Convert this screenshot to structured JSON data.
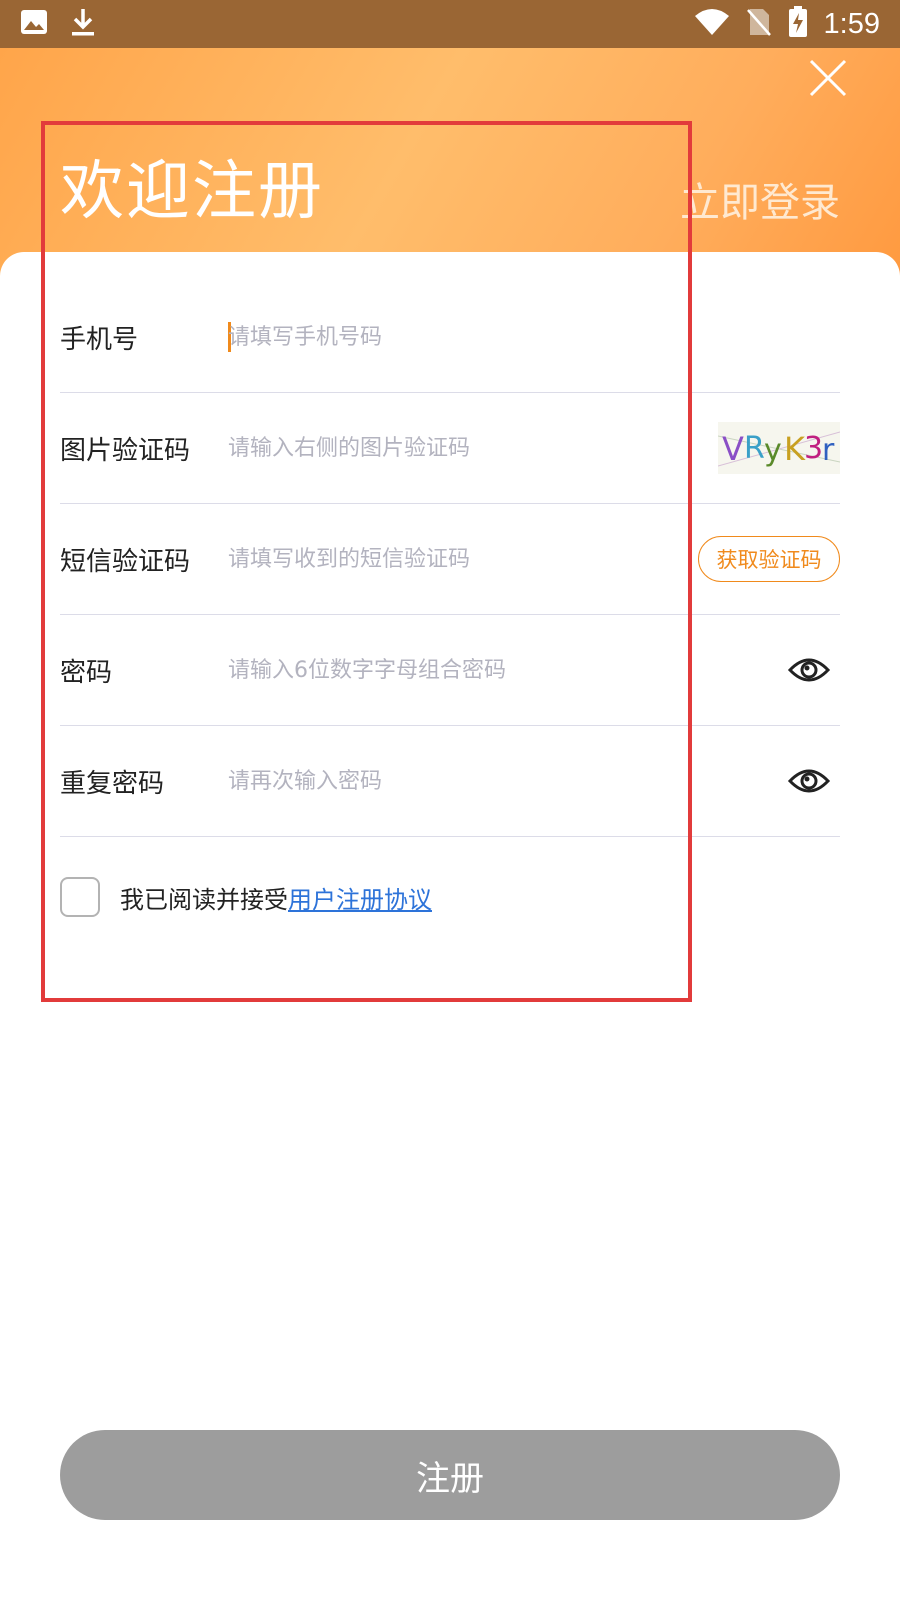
{
  "status_bar": {
    "time": "1:59",
    "icons": [
      "image-icon",
      "download-icon",
      "wifi-icon",
      "no-sim-icon",
      "battery-charging-icon"
    ]
  },
  "header": {
    "title": "欢迎注册",
    "login_link": "立即登录"
  },
  "form": {
    "phone": {
      "label": "手机号",
      "placeholder": "请填写手机号码"
    },
    "captcha": {
      "label": "图片验证码",
      "placeholder": "请输入右侧的图片验证码",
      "image_text": "VRyK3r"
    },
    "sms": {
      "label": "短信验证码",
      "placeholder": "请填写收到的短信验证码",
      "button": "获取验证码"
    },
    "password": {
      "label": "密码",
      "placeholder": "请输入6位数字字母组合密码"
    },
    "repeat_password": {
      "label": "重复密码",
      "placeholder": "请再次输入密码"
    }
  },
  "agreement": {
    "text": "我已阅读并接受",
    "link": "用户注册协议"
  },
  "submit_label": "注册",
  "colors": {
    "accent": "#f08a1c",
    "link": "#2d73d9",
    "button_disabled": "#9d9d9d",
    "status_bar": "#9a6634"
  }
}
